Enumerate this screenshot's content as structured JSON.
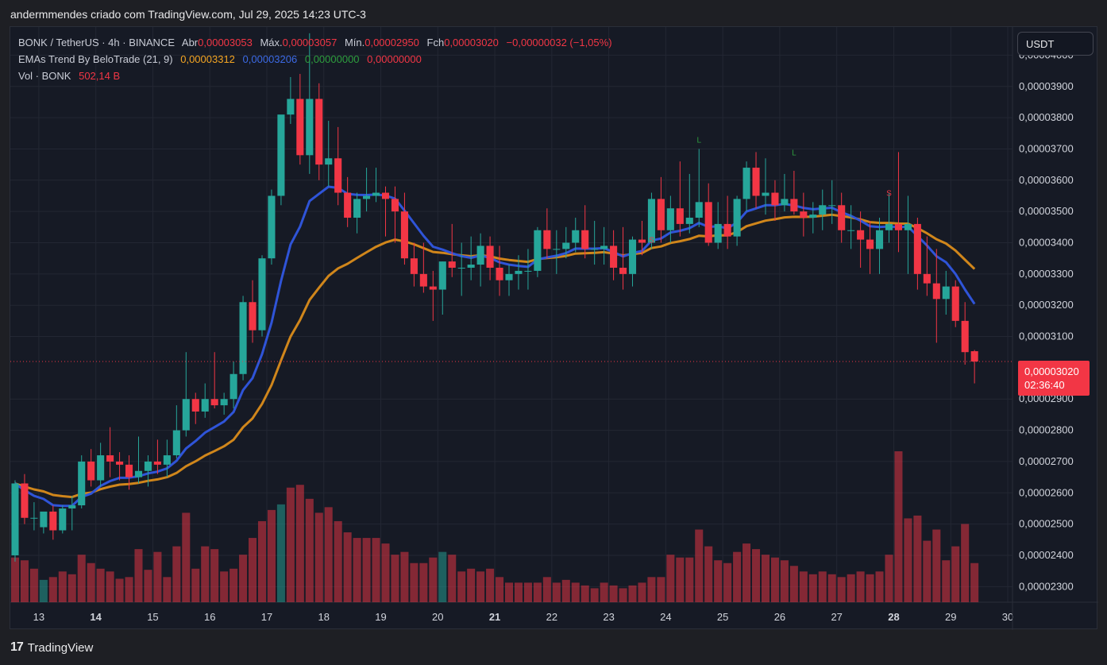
{
  "header": {
    "snapshot_text": "andermmendes criado com TradingView.com, Jul 29, 2025 14:23 UTC-3"
  },
  "legend": {
    "symbol": "BONK / TetherUS · 4h · BINANCE",
    "open_label": "Abr",
    "open_value": "0,00003053",
    "high_label": "Máx.",
    "high_value": "0,00003057",
    "low_label": "Mín.",
    "low_value": "0,00002950",
    "close_label": "Fch",
    "close_value": "0,00003020",
    "change": "−0,00000032 (−1,05%)",
    "indicator_name": "EMAs Trend By BeloTrade (21, 9)",
    "ind_v1": "0,00003312",
    "ind_v2": "0,00003206",
    "ind_v3": "0,00000000",
    "ind_v4": "0,00000000",
    "volume_label": "Vol · BONK",
    "volume_value": "502,14 B"
  },
  "currency_button": "USDT",
  "last_price": {
    "value": "0,00003020",
    "countdown": "02:36:40"
  },
  "footer": {
    "brand": "TradingView",
    "logo_glyph": "17"
  },
  "colors": {
    "up": "#26a69a",
    "down": "#f23645",
    "ema_fast": "#2f54d8",
    "ema_slow": "#d0861b",
    "grid": "#232733",
    "background": "#161a25"
  },
  "chart_data": {
    "type": "candlestick",
    "price_axis": {
      "min": 2.25e-05,
      "max": 4.09e-05,
      "ticks": [
        2.3e-05,
        2.4e-05,
        2.5e-05,
        2.6e-05,
        2.7e-05,
        2.8e-05,
        2.9e-05,
        3.1e-05,
        3.2e-05,
        3.3e-05,
        3.4e-05,
        3.5e-05,
        3.6e-05,
        3.7e-05,
        3.8e-05,
        3.9e-05,
        4e-05
      ],
      "tick_labels": [
        "0,00002300",
        "0,00002400",
        "0,00002500",
        "0,00002600",
        "0,00002700",
        "0,00002800",
        "0,00002900",
        "0,00003100",
        "0,00003200",
        "0,00003300",
        "0,00003400",
        "0,00003500",
        "0,00003600",
        "0,00003700",
        "0,00003800",
        "0,00003900",
        "0,00004000"
      ]
    },
    "time_axis": {
      "labels": [
        "13",
        "14",
        "15",
        "16",
        "17",
        "18",
        "19",
        "20",
        "21",
        "22",
        "23",
        "24",
        "25",
        "26",
        "27",
        "28",
        "29",
        "30"
      ],
      "label_index": [
        2.5,
        8.5,
        14.5,
        20.5,
        26.5,
        32.5,
        38.5,
        44.5,
        50.5,
        56.5,
        62.5,
        68.5,
        74.5,
        80.5,
        86.5,
        92.5,
        98.5,
        104.5
      ],
      "bold": [
        "14",
        "21",
        "28"
      ],
      "candles_per_day": 6,
      "visible_slots": 105.5
    },
    "volume_max": 2.7,
    "candles": [
      [
        2.4e-05,
        2.64e-05,
        2.63e-05,
        2.38e-05,
        0.8
      ],
      [
        2.63e-05,
        2.66e-05,
        2.52e-05,
        2.5e-05,
        0.75
      ],
      [
        2.52e-05,
        2.57e-05,
        2.52e-05,
        2.48e-05,
        0.6
      ],
      [
        2.49e-05,
        2.53e-05,
        2.54e-05,
        2.47e-05,
        0.4
      ],
      [
        2.54e-05,
        2.56e-05,
        2.48e-05,
        2.45e-05,
        0.45
      ],
      [
        2.48e-05,
        2.56e-05,
        2.55e-05,
        2.47e-05,
        0.55
      ],
      [
        2.55e-05,
        2.59e-05,
        2.56e-05,
        2.48e-05,
        0.5
      ],
      [
        2.56e-05,
        2.72e-05,
        2.7e-05,
        2.55e-05,
        0.85
      ],
      [
        2.7e-05,
        2.74e-05,
        2.64e-05,
        2.62e-05,
        0.7
      ],
      [
        2.64e-05,
        2.76e-05,
        2.72e-05,
        2.62e-05,
        0.6
      ],
      [
        2.72e-05,
        2.81e-05,
        2.7e-05,
        2.65e-05,
        0.55
      ],
      [
        2.7e-05,
        2.73e-05,
        2.69e-05,
        2.64e-05,
        0.42
      ],
      [
        2.69e-05,
        2.72e-05,
        2.65e-05,
        2.61e-05,
        0.45
      ],
      [
        2.65e-05,
        2.78e-05,
        2.67e-05,
        2.63e-05,
        0.95
      ],
      [
        2.67e-05,
        2.72e-05,
        2.7e-05,
        2.62e-05,
        0.58
      ],
      [
        2.7e-05,
        2.77e-05,
        2.69e-05,
        2.66e-05,
        0.9
      ],
      [
        2.69e-05,
        2.77e-05,
        2.72e-05,
        2.65e-05,
        0.45
      ],
      [
        2.72e-05,
        2.88e-05,
        2.8e-05,
        2.71e-05,
        1.0
      ],
      [
        2.8e-05,
        3.05e-05,
        2.9e-05,
        2.78e-05,
        1.6
      ],
      [
        2.9e-05,
        2.92e-05,
        2.86e-05,
        2.82e-05,
        0.6
      ],
      [
        2.86e-05,
        2.95e-05,
        2.9e-05,
        2.84e-05,
        1.0
      ],
      [
        2.9e-05,
        3.05e-05,
        2.88e-05,
        2.87e-05,
        0.95
      ],
      [
        2.88e-05,
        2.92e-05,
        2.9e-05,
        2.85e-05,
        0.55
      ],
      [
        2.9e-05,
        3.02e-05,
        2.98e-05,
        2.87e-05,
        0.6
      ],
      [
        2.98e-05,
        3.23e-05,
        3.21e-05,
        2.96e-05,
        0.85
      ],
      [
        3.21e-05,
        3.28e-05,
        3.12e-05,
        3.08e-05,
        1.15
      ],
      [
        3.12e-05,
        3.36e-05,
        3.35e-05,
        3.1e-05,
        1.45
      ],
      [
        3.35e-05,
        3.57e-05,
        3.55e-05,
        3.33e-05,
        1.65
      ],
      [
        3.55e-05,
        3.79e-05,
        3.81e-05,
        3.52e-05,
        1.75
      ],
      [
        3.81e-05,
        3.93e-05,
        3.86e-05,
        3.78e-05,
        2.05
      ],
      [
        3.86e-05,
        3.94e-05,
        3.68e-05,
        3.65e-05,
        2.1
      ],
      [
        3.68e-05,
        4.07e-05,
        3.86e-05,
        3.62e-05,
        1.85
      ],
      [
        3.86e-05,
        3.91e-05,
        3.65e-05,
        3.6e-05,
        1.6
      ],
      [
        3.65e-05,
        3.79e-05,
        3.67e-05,
        3.58e-05,
        1.7
      ],
      [
        3.67e-05,
        3.77e-05,
        3.56e-05,
        3.52e-05,
        1.45
      ],
      [
        3.56e-05,
        3.61e-05,
        3.48e-05,
        3.45e-05,
        1.25
      ],
      [
        3.48e-05,
        3.56e-05,
        3.54e-05,
        3.43e-05,
        1.15
      ],
      [
        3.54e-05,
        3.64e-05,
        3.55e-05,
        3.5e-05,
        1.15
      ],
      [
        3.55e-05,
        3.64e-05,
        3.56e-05,
        3.53e-05,
        1.15
      ],
      [
        3.56e-05,
        3.58e-05,
        3.54e-05,
        3.42e-05,
        1.05
      ],
      [
        3.54e-05,
        3.58e-05,
        3.5e-05,
        3.4e-05,
        0.85
      ],
      [
        3.5e-05,
        3.56e-05,
        3.35e-05,
        3.33e-05,
        0.9
      ],
      [
        3.35e-05,
        3.4e-05,
        3.3e-05,
        3.26e-05,
        0.7
      ],
      [
        3.3e-05,
        3.4e-05,
        3.26e-05,
        3.24e-05,
        0.7
      ],
      [
        3.26e-05,
        3.31e-05,
        3.25e-05,
        3.15e-05,
        0.8
      ],
      [
        3.25e-05,
        3.34e-05,
        3.34e-05,
        3.17e-05,
        0.9
      ],
      [
        3.34e-05,
        3.46e-05,
        3.32e-05,
        3.29e-05,
        0.85
      ],
      [
        3.32e-05,
        3.4e-05,
        3.32e-05,
        3.23e-05,
        0.55
      ],
      [
        3.32e-05,
        3.42e-05,
        3.33e-05,
        3.28e-05,
        0.6
      ],
      [
        3.33e-05,
        3.43e-05,
        3.39e-05,
        3.26e-05,
        0.55
      ],
      [
        3.39e-05,
        3.42e-05,
        3.32e-05,
        3.28e-05,
        0.6
      ],
      [
        3.32e-05,
        3.39e-05,
        3.28e-05,
        3.23e-05,
        0.45
      ],
      [
        3.28e-05,
        3.33e-05,
        3.3e-05,
        3.23e-05,
        0.35
      ],
      [
        3.3e-05,
        3.36e-05,
        3.31e-05,
        3.25e-05,
        0.35
      ],
      [
        3.31e-05,
        3.38e-05,
        3.31e-05,
        3.25e-05,
        0.35
      ],
      [
        3.31e-05,
        3.45e-05,
        3.44e-05,
        3.29e-05,
        0.35
      ],
      [
        3.44e-05,
        3.51e-05,
        3.38e-05,
        3.35e-05,
        0.45
      ],
      [
        3.38e-05,
        3.44e-05,
        3.38e-05,
        3.3e-05,
        0.35
      ],
      [
        3.38e-05,
        3.45e-05,
        3.4e-05,
        3.35e-05,
        0.4
      ],
      [
        3.4e-05,
        3.48e-05,
        3.44e-05,
        3.37e-05,
        0.35
      ],
      [
        3.44e-05,
        3.52e-05,
        3.38e-05,
        3.35e-05,
        0.3
      ],
      [
        3.38e-05,
        3.47e-05,
        3.38e-05,
        3.33e-05,
        0.25
      ],
      [
        3.38e-05,
        3.45e-05,
        3.39e-05,
        3.33e-05,
        0.35
      ],
      [
        3.39e-05,
        3.44e-05,
        3.32e-05,
        3.28e-05,
        0.3
      ],
      [
        3.32e-05,
        3.45e-05,
        3.3e-05,
        3.25e-05,
        0.25
      ],
      [
        3.3e-05,
        3.42e-05,
        3.41e-05,
        3.26e-05,
        0.3
      ],
      [
        3.41e-05,
        3.47e-05,
        3.4e-05,
        3.36e-05,
        0.35
      ],
      [
        3.4e-05,
        3.56e-05,
        3.54e-05,
        3.38e-05,
        0.45
      ],
      [
        3.54e-05,
        3.61e-05,
        3.44e-05,
        3.4e-05,
        0.45
      ],
      [
        3.44e-05,
        3.55e-05,
        3.51e-05,
        3.4e-05,
        0.85
      ],
      [
        3.51e-05,
        3.66e-05,
        3.46e-05,
        3.42e-05,
        0.8
      ],
      [
        3.46e-05,
        3.62e-05,
        3.48e-05,
        3.43e-05,
        0.8
      ],
      [
        3.48e-05,
        3.7e-05,
        3.53e-05,
        3.45e-05,
        1.3
      ],
      [
        3.53e-05,
        3.59e-05,
        3.4e-05,
        3.39e-05,
        1.0
      ],
      [
        3.4e-05,
        3.53e-05,
        3.46e-05,
        3.38e-05,
        0.75
      ],
      [
        3.46e-05,
        3.55e-05,
        3.42e-05,
        3.38e-05,
        0.7
      ],
      [
        3.42e-05,
        3.55e-05,
        3.54e-05,
        3.39e-05,
        0.9
      ],
      [
        3.54e-05,
        3.66e-05,
        3.64e-05,
        3.5e-05,
        1.05
      ],
      [
        3.64e-05,
        3.69e-05,
        3.55e-05,
        3.51e-05,
        0.95
      ],
      [
        3.55e-05,
        3.67e-05,
        3.56e-05,
        3.49e-05,
        0.85
      ],
      [
        3.56e-05,
        3.6e-05,
        3.52e-05,
        3.47e-05,
        0.8
      ],
      [
        3.52e-05,
        3.62e-05,
        3.54e-05,
        3.5e-05,
        0.75
      ],
      [
        3.54e-05,
        3.63e-05,
        3.5e-05,
        3.49e-05,
        0.65
      ],
      [
        3.5e-05,
        3.56e-05,
        3.48e-05,
        3.42e-05,
        0.55
      ],
      [
        3.48e-05,
        3.53e-05,
        3.49e-05,
        3.43e-05,
        0.5
      ],
      [
        3.49e-05,
        3.57e-05,
        3.52e-05,
        3.44e-05,
        0.55
      ],
      [
        3.52e-05,
        3.6e-05,
        3.52e-05,
        3.46e-05,
        0.5
      ],
      [
        3.52e-05,
        3.56e-05,
        3.44e-05,
        3.4e-05,
        0.45
      ],
      [
        3.44e-05,
        3.52e-05,
        3.44e-05,
        3.38e-05,
        0.5
      ],
      [
        3.44e-05,
        3.5e-05,
        3.41e-05,
        3.32e-05,
        0.55
      ],
      [
        3.41e-05,
        3.47e-05,
        3.38e-05,
        3.3e-05,
        0.5
      ],
      [
        3.38e-05,
        3.48e-05,
        3.44e-05,
        3.3e-05,
        0.55
      ],
      [
        3.44e-05,
        3.56e-05,
        3.46e-05,
        3.4e-05,
        0.85
      ],
      [
        3.46e-05,
        3.69e-05,
        3.44e-05,
        3.37e-05,
        2.7
      ],
      [
        3.44e-05,
        3.55e-05,
        3.46e-05,
        3.3e-05,
        1.5
      ],
      [
        3.46e-05,
        3.48e-05,
        3.3e-05,
        3.25e-05,
        1.55
      ],
      [
        3.3e-05,
        3.42e-05,
        3.27e-05,
        3.23e-05,
        1.1
      ],
      [
        3.27e-05,
        3.38e-05,
        3.22e-05,
        3.08e-05,
        1.3
      ],
      [
        3.22e-05,
        3.31e-05,
        3.26e-05,
        3.17e-05,
        0.75
      ],
      [
        3.26e-05,
        3.28e-05,
        3.15e-05,
        3.13e-05,
        1.0
      ],
      [
        3.15e-05,
        3.21e-05,
        3.05e-05,
        3.01e-05,
        1.4
      ],
      [
        3.053e-05,
        3.057e-05,
        3.02e-05,
        2.95e-05,
        0.7
      ]
    ],
    "signals": [
      {
        "label": "L",
        "index": 72,
        "price": 3.72e-05,
        "color": "#2e9e3e"
      },
      {
        "label": "L",
        "index": 82,
        "price": 3.68e-05,
        "color": "#2e9e3e"
      },
      {
        "label": "S",
        "index": 67,
        "price": 3.4e-05,
        "color": "#f23645"
      },
      {
        "label": "S",
        "index": 92,
        "price": 3.55e-05,
        "color": "#f23645"
      }
    ]
  }
}
